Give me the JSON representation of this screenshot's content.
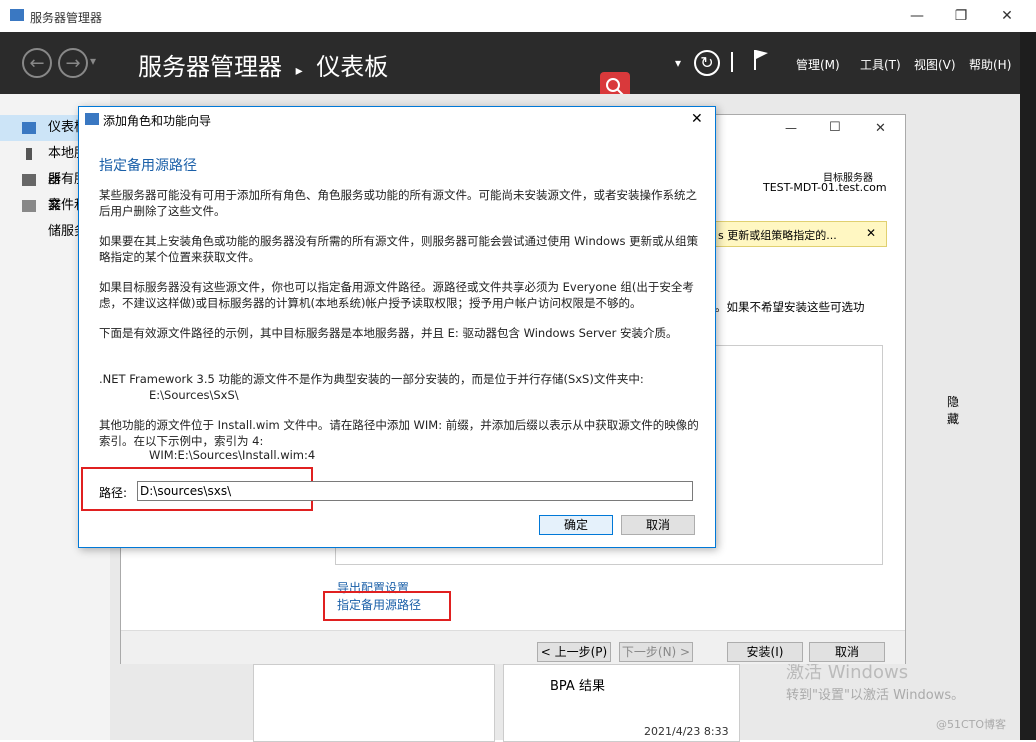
{
  "window": {
    "title": "服务器管理器",
    "minimize": "—",
    "restore": "❐",
    "close": "✕"
  },
  "header": {
    "back": "←",
    "forward": "→",
    "dropdown": "▾",
    "breadcrumb_app": "服务器管理器",
    "breadcrumb_sep": "▸",
    "breadcrumb_page": "仪表板",
    "refresh": "↻",
    "menus": [
      "管理(M)",
      "工具(T)",
      "视图(V)",
      "帮助(H)"
    ]
  },
  "sidebar": {
    "items": [
      {
        "label": "仪表板"
      },
      {
        "label": "本地服务器"
      },
      {
        "label": "所有服务器"
      },
      {
        "label": "文件和存储服务"
      }
    ]
  },
  "wizard": {
    "target_label": "目标服务器",
    "target_server": "TEST-MDT-01.test.com",
    "notice_text": "s 更新或组策略指定的...",
    "notice_close": "✕",
    "side_text": "。如果不希望安装这些可选功",
    "hide_label": "隐藏",
    "export_link": "导出配置设置",
    "alt_source_link": "指定备用源路径",
    "buttons": {
      "prev": "< 上一步(P)",
      "next": "下一步(N) >",
      "install": "安装(I)",
      "cancel": "取消"
    },
    "win_minimize": "—",
    "win_maximize": "☐",
    "win_close": "✕"
  },
  "background": {
    "bpa_label": "BPA 结果",
    "timestamp": "2021/4/23 8:33",
    "activate_title": "激活 Windows",
    "activate_text": "转到\"设置\"以激活 Windows。",
    "watermark": "@51CTO博客"
  },
  "dialog": {
    "title": "添加角色和功能向导",
    "close": "✕",
    "heading": "指定备用源路径",
    "para1": "某些服务器可能没有可用于添加所有角色、角色服务或功能的所有源文件。可能尚未安装源文件，或者安装操作系统之后用户删除了这些文件。",
    "para2": "如果要在其上安装角色或功能的服务器没有所需的所有源文件，则服务器可能会尝试通过使用 Windows 更新或从组策略指定的某个位置来获取文件。",
    "para3": "如果目标服务器没有这些源文件，你也可以指定备用源文件路径。源路径或文件共享必须为 Everyone 组(出于安全考虑，不建议这样做)或目标服务器的计算机(本地系统)帐户授予读取权限；授予用户帐户访问权限是不够的。",
    "para4": "下面是有效源文件路径的示例，其中目标服务器是本地服务器，并且 E: 驱动器包含 Windows Server 安装介质。",
    "para5": ".NET Framework 3.5 功能的源文件不是作为典型安装的一部分安装的，而是位于并行存储(SxS)文件夹中:",
    "example1": "E:\\Sources\\SxS\\",
    "para6": "其他功能的源文件位于 Install.wim 文件中。请在路径中添加 WIM: 前缀，并添加后缀以表示从中获取源文件的映像的索引。在以下示例中，索引为 4:",
    "example2": "WIM:E:\\Sources\\Install.wim:4",
    "path_label": "路径:",
    "path_value": "D:\\sources\\sxs\\",
    "ok": "确定",
    "cancel": "取消"
  },
  "colors": {
    "header_bg": "#2b2b2b",
    "accent": "#0078d7",
    "highlight_red": "#e02020",
    "search_badge": "#d9393b"
  }
}
